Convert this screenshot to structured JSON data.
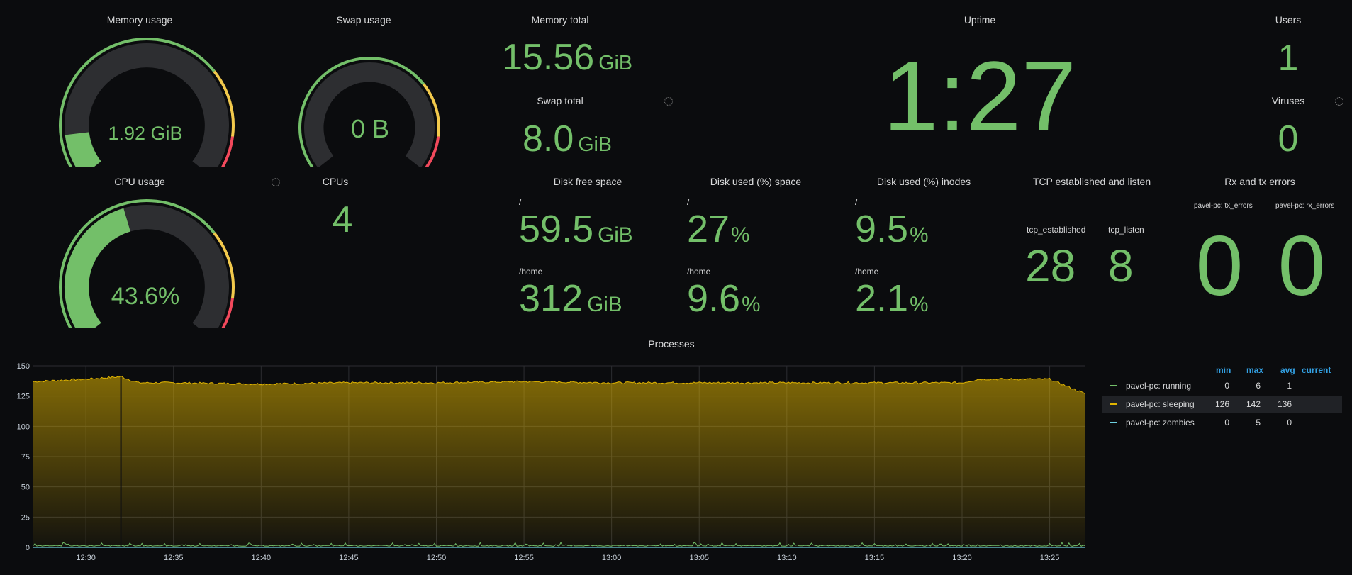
{
  "colors": {
    "green": "#73bf69",
    "yellow": "#f2c94c",
    "red": "#f2495c",
    "track": "#2d2e31",
    "processes_fill": "#e0b400",
    "blue_legend": "#33a2e5",
    "zombie": "#6ed0e0"
  },
  "memory_usage": {
    "title": "Memory usage",
    "value": "1.92 GiB",
    "fraction": 0.123
  },
  "swap_usage": {
    "title": "Swap usage",
    "value": "0 B",
    "fraction": 0.0
  },
  "memory_total": {
    "title": "Memory total",
    "value": "15.56",
    "unit": "GiB"
  },
  "swap_total": {
    "title": "Swap total",
    "value": "8.0",
    "unit": "GiB"
  },
  "uptime": {
    "title": "Uptime",
    "value": "1:27"
  },
  "users": {
    "title": "Users",
    "value": "1"
  },
  "viruses": {
    "title": "Viruses",
    "value": "0"
  },
  "cpu_usage": {
    "title": "CPU usage",
    "value": "43.6%",
    "fraction": 0.436
  },
  "cpus": {
    "title": "CPUs",
    "value": "4"
  },
  "disk_free": {
    "title": "Disk free space",
    "root_label": "/",
    "root_value": "59.5",
    "root_unit": "GiB",
    "home_label": "/home",
    "home_value": "312",
    "home_unit": "GiB"
  },
  "disk_used_space": {
    "title": "Disk used (%) space",
    "root_label": "/",
    "root_value": "27",
    "root_unit": "%",
    "home_label": "/home",
    "home_value": "9.6",
    "home_unit": "%"
  },
  "disk_used_inodes": {
    "title": "Disk used (%) inodes",
    "root_label": "/",
    "root_value": "9.5",
    "root_unit": "%",
    "home_label": "/home",
    "home_value": "2.1",
    "home_unit": "%"
  },
  "tcp": {
    "title": "TCP established and listen",
    "established_label": "tcp_established",
    "established_value": "28",
    "listen_label": "tcp_listen",
    "listen_value": "8"
  },
  "rx_tx": {
    "title": "Rx and tx errors",
    "tx_label": "pavel-pc: tx_errors",
    "tx_value": "0",
    "rx_label": "pavel-pc: rx_errors",
    "rx_value": "0"
  },
  "processes": {
    "title": "Processes",
    "legend_headers": {
      "min": "min",
      "max": "max",
      "avg": "avg",
      "current": "current"
    },
    "legend": [
      {
        "name": "pavel-pc: running",
        "min": "0",
        "max": "6",
        "avg": "1",
        "color": "#73bf69"
      },
      {
        "name": "pavel-pc: sleeping",
        "min": "126",
        "max": "142",
        "avg": "136",
        "color": "#e0b400"
      },
      {
        "name": "pavel-pc: zombies",
        "min": "0",
        "max": "5",
        "avg": "0",
        "color": "#6ed0e0"
      }
    ]
  },
  "chart_data": {
    "type": "area",
    "title": "Processes",
    "ylim": [
      0,
      150
    ],
    "yticks": [
      "0",
      "25",
      "50",
      "75",
      "100",
      "125",
      "150"
    ],
    "xticks": [
      "12:30",
      "12:35",
      "12:40",
      "12:45",
      "12:50",
      "12:55",
      "13:00",
      "13:05",
      "13:10",
      "13:15",
      "13:20",
      "13:25"
    ],
    "xlim": [
      "12:27",
      "13:27"
    ],
    "grid": true,
    "legend": "right",
    "series": [
      {
        "name": "pavel-pc: sleeping",
        "x": [
          "12:27",
          "12:30",
          "12:32",
          "12:33",
          "12:35",
          "12:40",
          "12:45",
          "12:50",
          "12:55",
          "13:00",
          "13:05",
          "13:10",
          "13:15",
          "13:20",
          "13:21",
          "13:25",
          "13:27"
        ],
        "values": [
          137,
          139,
          141,
          136,
          136,
          135,
          136,
          136,
          137,
          136,
          136,
          136,
          136,
          136,
          139,
          139,
          127
        ]
      },
      {
        "name": "pavel-pc: running",
        "x": [
          "12:27",
          "13:27"
        ],
        "values": [
          1,
          1
        ]
      },
      {
        "name": "pavel-pc: zombies",
        "x": [
          "12:27",
          "13:27"
        ],
        "values": [
          0,
          0
        ]
      }
    ]
  }
}
